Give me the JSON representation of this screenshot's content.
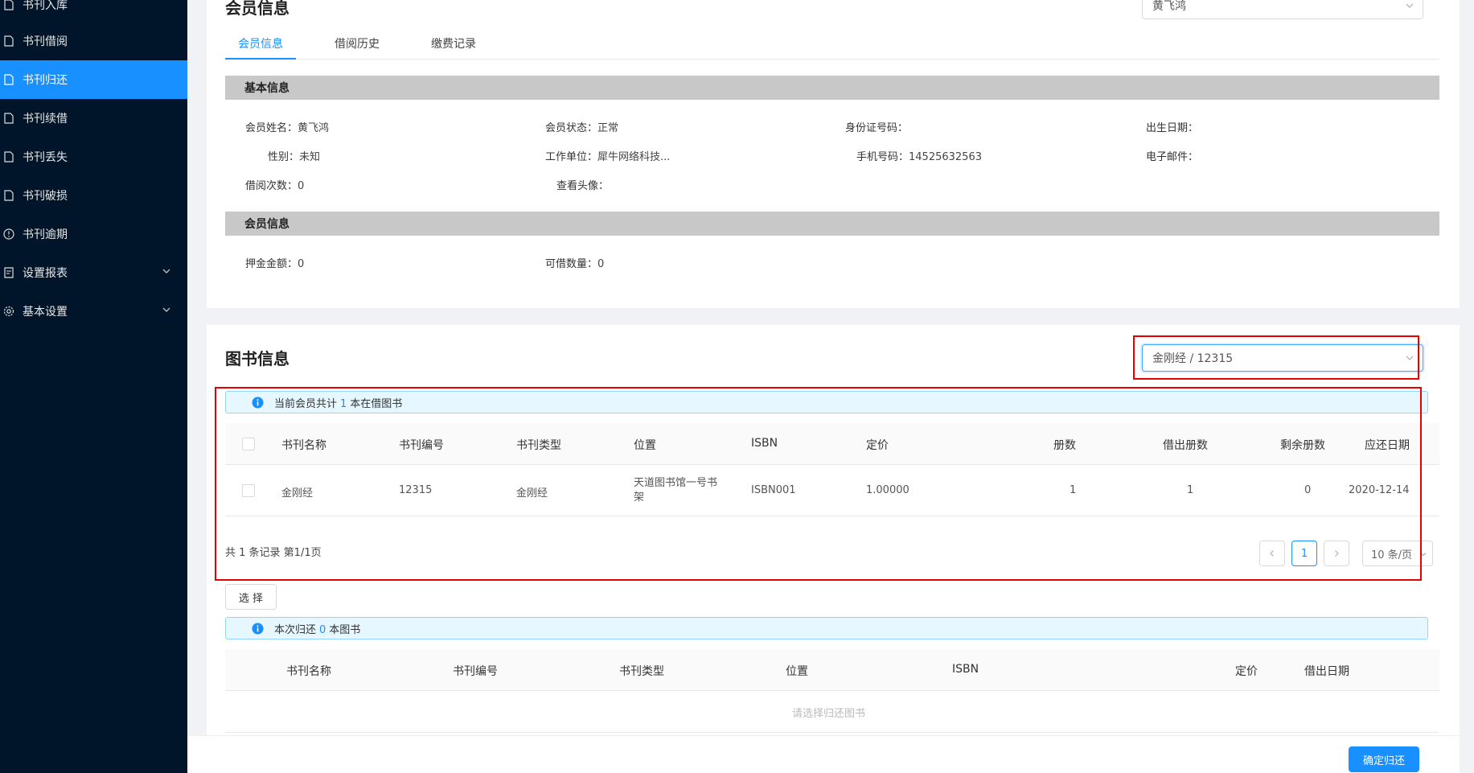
{
  "sidebar": {
    "items": [
      {
        "label": "书刊入库",
        "icon": "file-icon"
      },
      {
        "label": "书刊借阅",
        "icon": "file-icon"
      },
      {
        "label": "书刊归还",
        "icon": "file-icon",
        "active": true
      },
      {
        "label": "书刊续借",
        "icon": "file-icon"
      },
      {
        "label": "书刊丢失",
        "icon": "file-icon"
      },
      {
        "label": "书刊破损",
        "icon": "file-icon"
      },
      {
        "label": "书刊逾期",
        "icon": "clock-icon"
      },
      {
        "label": "设置报表",
        "icon": "report-icon",
        "expandable": true
      },
      {
        "label": "基本设置",
        "icon": "gear-icon",
        "expandable": true
      }
    ]
  },
  "member": {
    "title": "会员信息",
    "select_value": "黄飞鸿",
    "tabs": [
      "会员信息",
      "借阅历史",
      "缴费记录"
    ],
    "basic_section": "基本信息",
    "fields": {
      "name_label": "会员姓名：",
      "name": "黄飞鸿",
      "status_label": "会员状态：",
      "status": "正常",
      "id_label": "身份证号码：",
      "id": "",
      "birth_label": "出生日期：",
      "birth": "",
      "gender_label": "性别：",
      "gender": "未知",
      "work_label": "工作单位：",
      "work": "犀牛网络科技...",
      "phone_label": "手机号码：",
      "phone": "14525632563",
      "email_label": "电子邮件：",
      "email": "",
      "borrow_count_label": "借阅次数：",
      "borrow_count": "0",
      "avatar_label": "查看头像：",
      "avatar": ""
    },
    "member_section": "会员信息",
    "deposit_label": "押金金额：",
    "deposit": "0",
    "borrowable_label": "可借数量：",
    "borrowable": "0"
  },
  "books": {
    "title": "图书信息",
    "select_value": "金刚经 / 12315",
    "alert": {
      "prefix": "当前会员共计",
      "count": "1",
      "suffix": "本在借图书"
    },
    "columns": [
      "书刊名称",
      "书刊编号",
      "书刊类型",
      "位置",
      "ISBN",
      "定价",
      "册数",
      "借出册数",
      "剩余册数",
      "应还日期"
    ],
    "rows": [
      {
        "name": "金刚经",
        "code": "12315",
        "type": "金刚经",
        "location_line1": "天道图书馆一号书",
        "location_line2": "架",
        "isbn": "ISBN001",
        "price": "1.00000",
        "copies": "1",
        "lent": "1",
        "remaining": "0",
        "due": "2020-12-14"
      }
    ],
    "pagination": {
      "summary": "共 1 条记录 第1/1页",
      "current": "1",
      "page_size": "10 条/页"
    },
    "select_button": "选 择",
    "return_alert": {
      "prefix": "本次归还",
      "count": "0",
      "suffix": "本图书"
    },
    "return_columns": [
      "书刊名称",
      "书刊编号",
      "书刊类型",
      "位置",
      "ISBN",
      "定价",
      "借出日期"
    ],
    "empty_text": "请选择归还图书",
    "confirm_button": "确定归还"
  },
  "colors": {
    "primary": "#1890ff",
    "sidebar": "#001529",
    "highlight": "#e60000"
  }
}
